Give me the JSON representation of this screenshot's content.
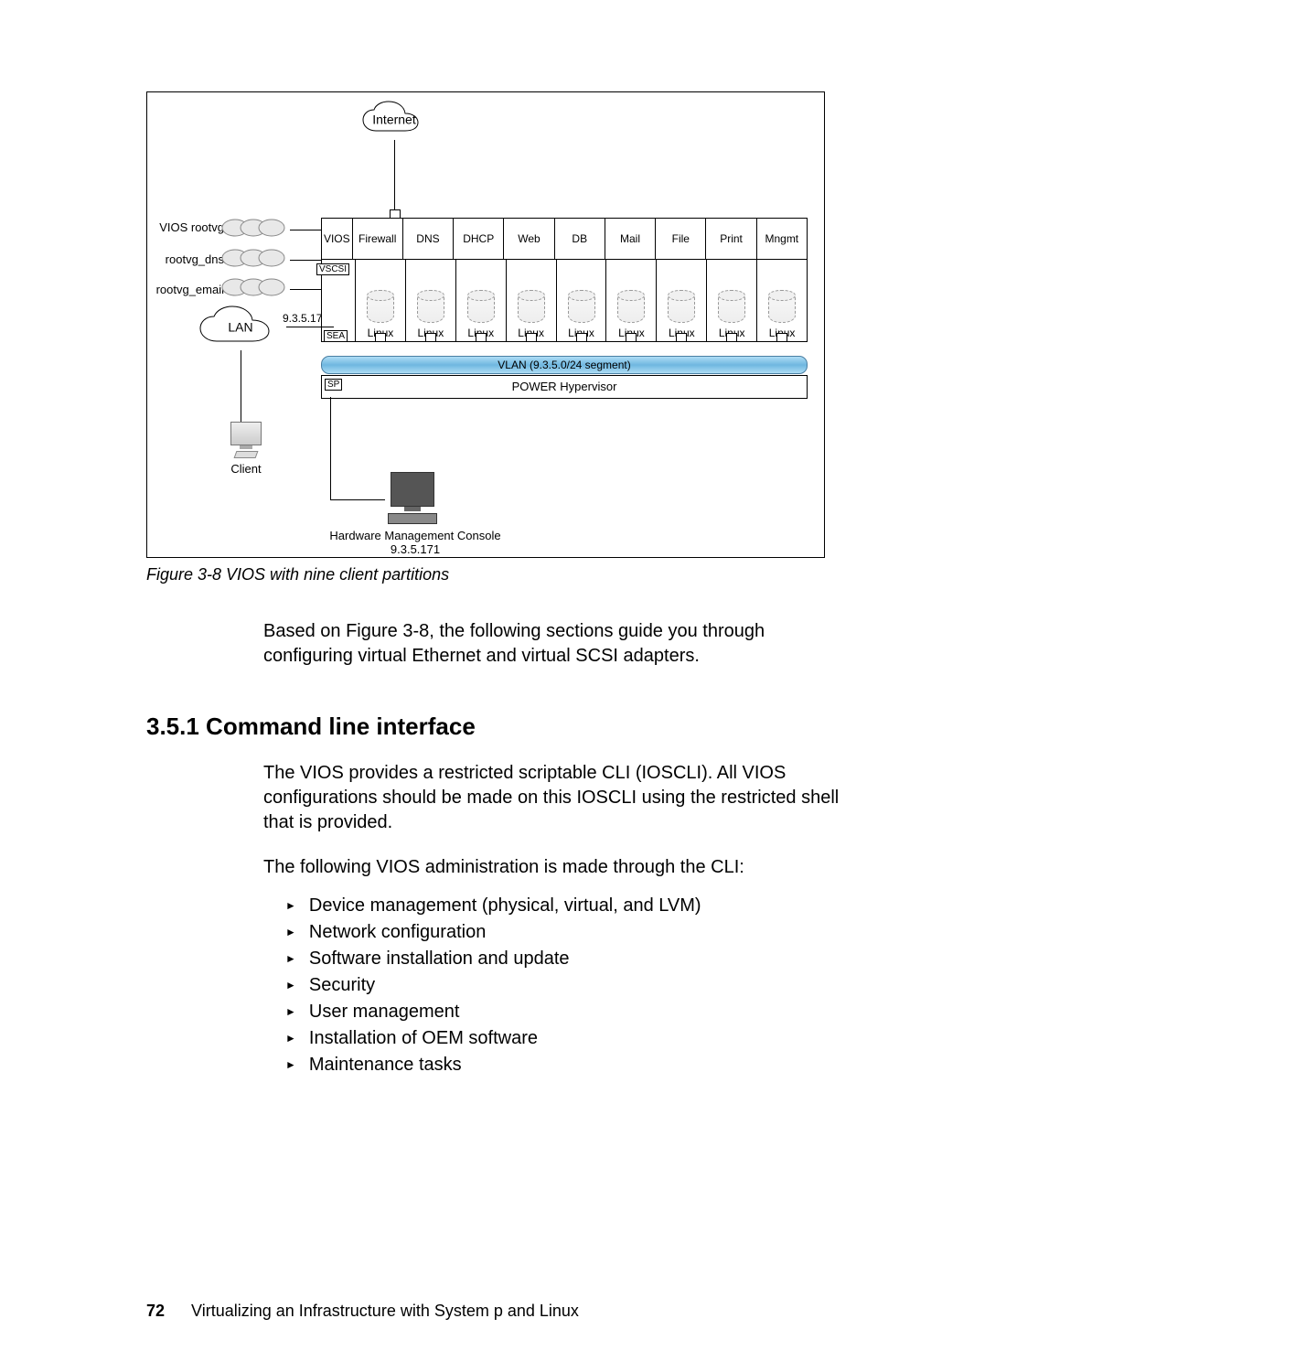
{
  "figure": {
    "internet": "Internet",
    "lan": "LAN",
    "lan_ip": "9.3.5.17",
    "left_labels": {
      "vios_rootvg": "VIOS rootvg",
      "rootvg_dns": "rootvg_dns",
      "rootvg_email": "rootvg_email"
    },
    "partitions_top": [
      "VIOS",
      "Firewall",
      "DNS",
      "DHCP",
      "Web",
      "DB",
      "Mail",
      "File",
      "Print",
      "Mngmt"
    ],
    "partitions_linux": "Linux",
    "vscsi_tag": "VSCSI",
    "sea_tag": "SEA",
    "sp_tag": "SP",
    "vlan": "VLAN (9.3.5.0/24 segment)",
    "hypervisor": "POWER Hypervisor",
    "client": "Client",
    "hmc_label1": "Hardware Management Console",
    "hmc_label2": "9.3.5.171",
    "caption": "Figure 3-8   VIOS with nine client partitions"
  },
  "body": {
    "p1": "Based on Figure 3-8, the following sections guide you through configuring virtual Ethernet and virtual SCSI adapters.",
    "heading": "3.5.1  Command line interface",
    "p2": "The VIOS provides a restricted scriptable CLI (IOSCLI). All VIOS configurations should be made on this IOSCLI using the restricted shell that is provided.",
    "p3": "The following VIOS administration is made through the CLI:",
    "list": [
      "Device management (physical, virtual, and LVM)",
      "Network configuration",
      "Software installation and update",
      "Security",
      "User management",
      "Installation of OEM software",
      "Maintenance tasks"
    ]
  },
  "footer": {
    "page": "72",
    "book": "Virtualizing an Infrastructure with System p and Linux"
  }
}
